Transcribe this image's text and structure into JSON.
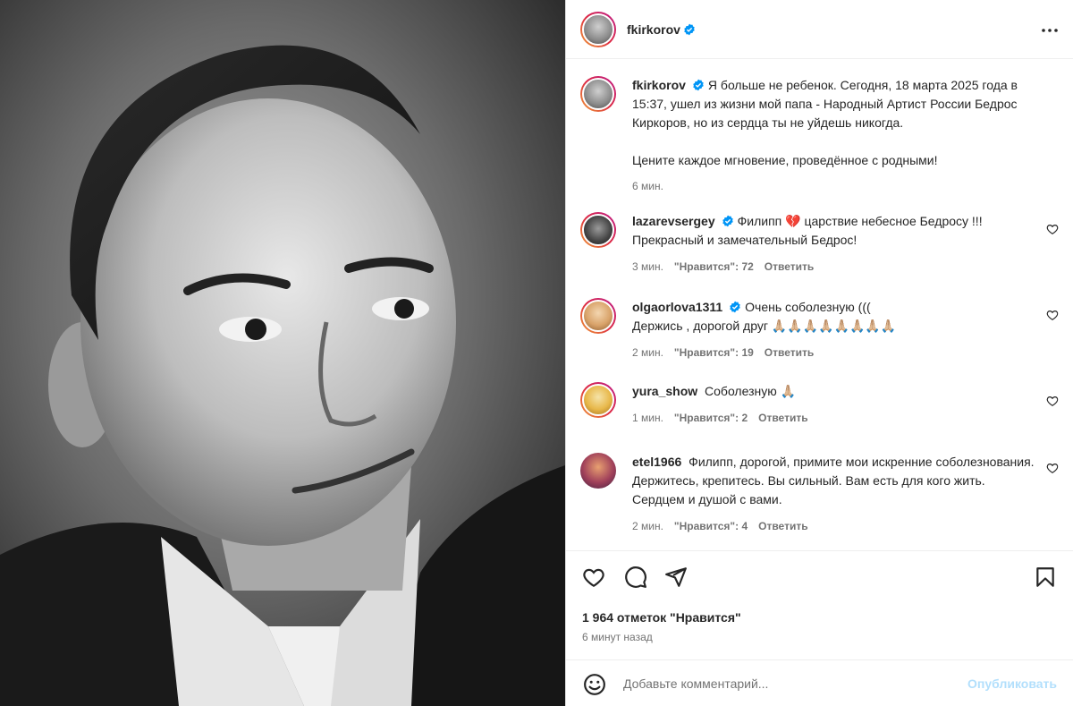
{
  "post": {
    "author": "fkirkorov",
    "more_icon": "more-horizontal-icon"
  },
  "caption": {
    "author": "fkirkorov",
    "text": "Я больше не ребенок. Сегодня, 18 марта 2025 года в 15:37, ушел из жизни мой папа - Народный Артист России Бедрос Киркоров, но из сердца ты не уйдешь никогда.",
    "text2": "Цените каждое мгновение, проведённое с родными!",
    "time": "6 мин."
  },
  "comments": [
    {
      "author": "lazarevsergey",
      "verified": true,
      "text_before": "Филипп",
      "emoji": "💔",
      "text_after": " царствие небесное Бедросу !!! Прекрасный и замечательный Бедрос!",
      "time": "3 мин.",
      "likes": "\"Нравится\": 72",
      "reply": "Ответить"
    },
    {
      "author": "olgaorlova1311",
      "verified": true,
      "text": "Очень соболезную (((",
      "text2": "Держись , дорогой друг",
      "emoji": "🙏🏼🙏🏼🙏🏼🙏🏼🙏🏼🙏🏼🙏🏼🙏🏼",
      "time": "2 мин.",
      "likes": "\"Нравится\": 19",
      "reply": "Ответить"
    },
    {
      "author": "yura_show",
      "verified": false,
      "text": "Соболезную",
      "emoji": "🙏🏼",
      "time": "1 мин.",
      "likes": "\"Нравится\": 2",
      "reply": "Ответить"
    },
    {
      "author": "etel1966",
      "verified": false,
      "text": "Филипп, дорогой, примите мои искренние соболезнования. Держитесь, крепитесь. Вы сильный. Вам есть для кого жить. Сердцем и душой с вами.",
      "time": "2 мин.",
      "likes": "\"Нравится\": 4",
      "reply": "Ответить"
    }
  ],
  "actions": {
    "likes_count": "1 964 отметок \"Нравится\"",
    "time_ago": "6 минут назад"
  },
  "add_comment": {
    "placeholder": "Добавьте комментарий...",
    "publish_label": "Опубликовать"
  },
  "colors": {
    "accent": "#0095f6",
    "publish_disabled": "#b2dffc",
    "muted": "#737373",
    "border": "#dbdbdb"
  }
}
